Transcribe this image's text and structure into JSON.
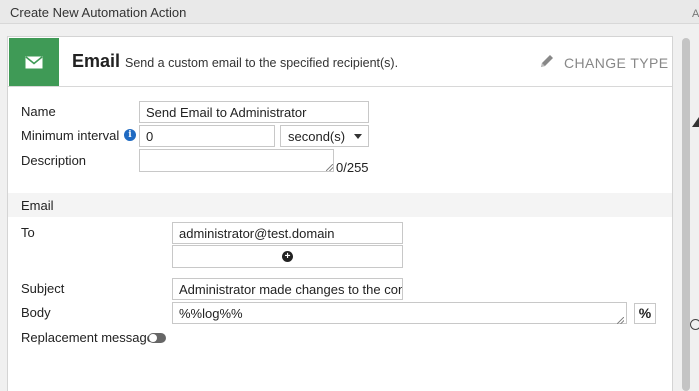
{
  "window": {
    "title": "Create New Automation Action"
  },
  "header": {
    "icon": "envelope-icon",
    "title": "Email",
    "description": "Send a custom email to the specified recipient(s).",
    "change_type_label": "CHANGE TYPE",
    "change_type_icon": "pencil-icon",
    "accent_color": "#3f9a56"
  },
  "form": {
    "name_label": "Name",
    "name_value": "Send Email to Administrator",
    "min_interval_label": "Minimum interval",
    "min_interval_value": "0",
    "min_interval_unit": "second(s)",
    "description_label": "Description",
    "description_value": "",
    "description_counter": "0/255"
  },
  "email": {
    "section_title": "Email",
    "to_label": "To",
    "to_value": "administrator@test.domain",
    "subject_label": "Subject",
    "subject_value": "Administrator made changes to the con",
    "body_label": "Body",
    "body_value": "%%log%%",
    "body_variable_button": "%",
    "replacement_label": "Replacement message",
    "replacement_enabled": false
  },
  "right_panel": {
    "label": "A"
  }
}
